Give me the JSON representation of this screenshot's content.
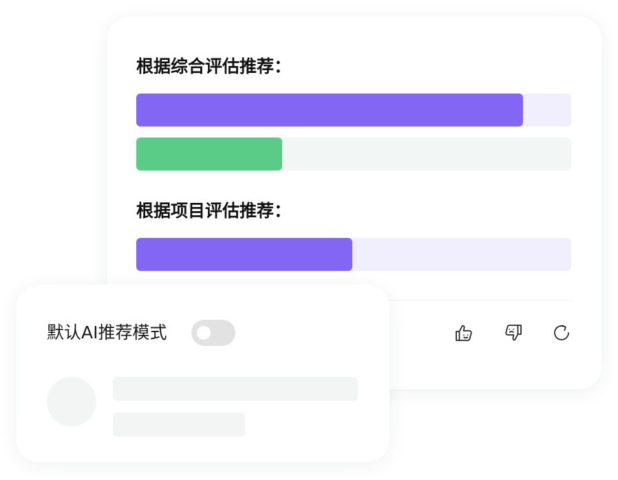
{
  "recommendations": {
    "overall_title": "根据综合评估推荐：",
    "overall_bars": [
      {
        "fill_percent": 89,
        "fill_color": "#8466f5",
        "track_color": "#f1effe"
      },
      {
        "fill_percent": 33.5,
        "fill_color": "#5bcb88",
        "track_color": "#f2f6f4"
      }
    ],
    "project_title": "根据项目评估推荐：",
    "project_bars": [
      {
        "fill_percent": 49.7,
        "fill_color": "#8466f5",
        "track_color": "#f1effe"
      }
    ]
  },
  "actions": {
    "icons": [
      "thumbs-up-icon",
      "thumbs-down-icon",
      "refresh-icon"
    ]
  },
  "settings": {
    "default_ai_label": "默认AI推荐模式",
    "default_ai_enabled": false
  }
}
